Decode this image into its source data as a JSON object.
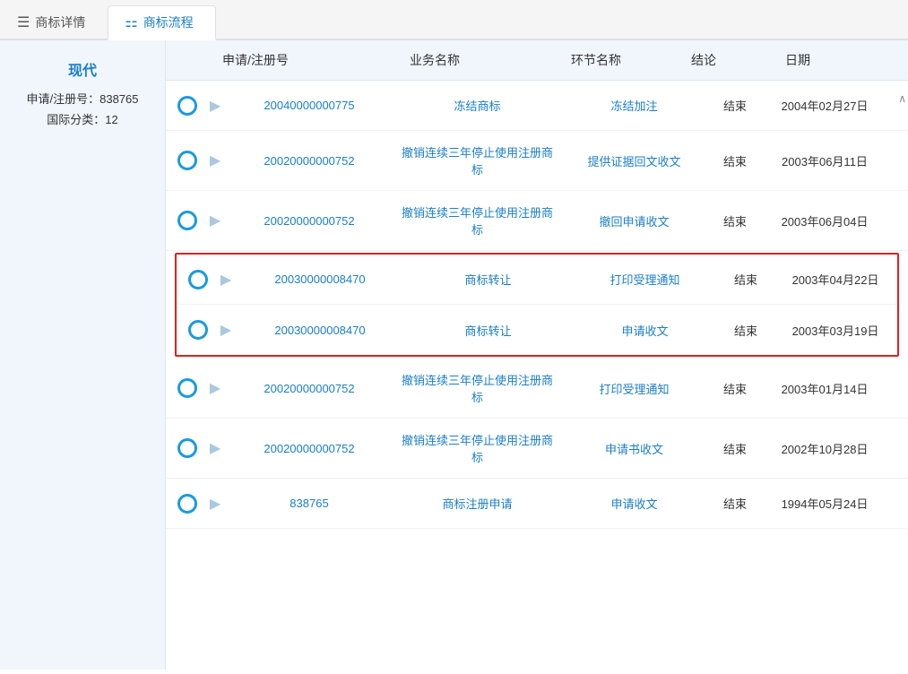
{
  "tabs": [
    {
      "label": "商标详情",
      "icon": "☰",
      "active": false
    },
    {
      "label": "商标流程",
      "icon": "⚏",
      "active": true
    }
  ],
  "leftPanel": {
    "brandName": "现代",
    "appNo": "申请/注册号：838765",
    "intClass": "国际分类：12"
  },
  "tableHeader": {
    "col1": "申请/注册号",
    "col2": "业务名称",
    "col3": "环节名称",
    "col4": "结论",
    "col5": "日期"
  },
  "rows": [
    {
      "id": "row-1",
      "appNo": "20040000000775",
      "bizName": "冻结商标",
      "stageName": "冻结加注",
      "conclusion": "结束",
      "date": "2004年02月27日",
      "highlighted": false
    },
    {
      "id": "row-2",
      "appNo": "20020000000752",
      "bizName": "撤销连续三年停止使用注册商标",
      "stageName": "提供证据回文收文",
      "conclusion": "结束",
      "date": "2003年06月11日",
      "highlighted": false
    },
    {
      "id": "row-3",
      "appNo": "20020000000752",
      "bizName": "撤销连续三年停止使用注册商标",
      "stageName": "撤回申请收文",
      "conclusion": "结束",
      "date": "2003年06月04日",
      "highlighted": false
    },
    {
      "id": "row-4",
      "appNo": "20030000008470",
      "bizName": "商标转让",
      "stageName": "打印受理通知",
      "conclusion": "结束",
      "date": "2003年04月22日",
      "highlighted": true
    },
    {
      "id": "row-5",
      "appNo": "20030000008470",
      "bizName": "商标转让",
      "stageName": "申请收文",
      "conclusion": "结束",
      "date": "2003年03月19日",
      "highlighted": true
    },
    {
      "id": "row-6",
      "appNo": "20020000000752",
      "bizName": "撤销连续三年停止使用注册商标",
      "stageName": "打印受理通知",
      "conclusion": "结束",
      "date": "2003年01月14日",
      "highlighted": false
    },
    {
      "id": "row-7",
      "appNo": "20020000000752",
      "bizName": "撤销连续三年停止使用注册商标",
      "stageName": "申请书收文",
      "conclusion": "结束",
      "date": "2002年10月28日",
      "highlighted": false
    },
    {
      "id": "row-8",
      "appNo": "838765",
      "bizName": "商标注册申请",
      "stageName": "申请收文",
      "conclusion": "结束",
      "date": "1994年05月24日",
      "highlighted": false
    }
  ],
  "colors": {
    "blue": "#1a7ec8",
    "circleBorder": "#1a9ae0",
    "highlight": "#e02020",
    "headerBg": "#f0f6fb"
  }
}
